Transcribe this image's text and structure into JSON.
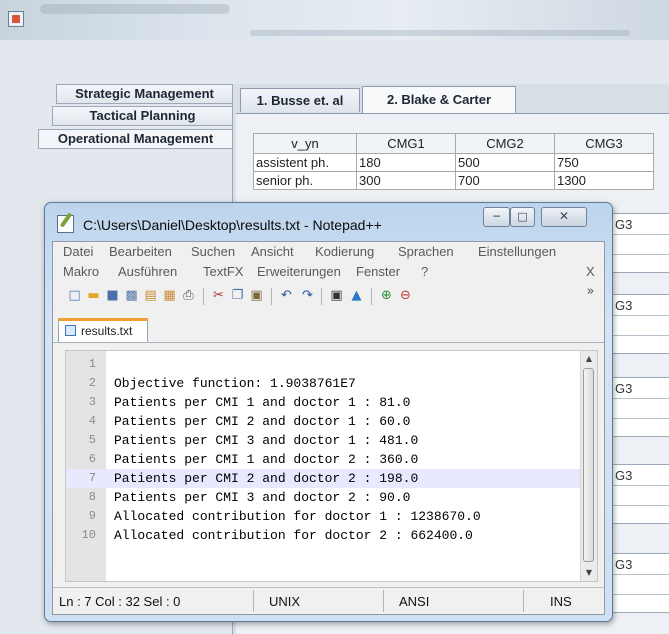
{
  "left_tabs": [
    "Strategic Management",
    "Tactical Planning",
    "Operational Management"
  ],
  "top_tabs": [
    "1. Busse et. al",
    "2. Blake & Carter"
  ],
  "table": {
    "headers": [
      "v_yn",
      "CMG1",
      "CMG2",
      "CMG3"
    ],
    "rows": [
      [
        "assistent ph.",
        "180",
        "500",
        "750"
      ],
      [
        "senior ph.",
        "300",
        "700",
        "1300"
      ]
    ]
  },
  "background_labels": [
    "G3",
    "G3",
    "G3",
    "G3",
    "G3"
  ],
  "notepad": {
    "title": "C:\\Users\\Daniel\\Desktop\\results.txt - Notepad++",
    "menu_row1": [
      "Datei",
      "Bearbeiten",
      "Suchen",
      "Ansicht",
      "Kodierung",
      "Sprachen",
      "Einstellungen"
    ],
    "menu_row2": [
      "Makro",
      "Ausführen",
      "TextFX",
      "Erweiterungen",
      "Fenster",
      "?"
    ],
    "menu_close": "X",
    "toolbar_more": "»",
    "tab_name": "results.txt",
    "lines": [
      {
        "num": "1",
        "text": ""
      },
      {
        "num": "2",
        "text": "Objective function: 1.9038761E7"
      },
      {
        "num": "3",
        "text": "Patients per CMI 1 and doctor 1 : 81.0"
      },
      {
        "num": "4",
        "text": "Patients per CMI 2 and doctor 1 : 60.0"
      },
      {
        "num": "5",
        "text": "Patients per CMI 3 and doctor 1 : 481.0"
      },
      {
        "num": "6",
        "text": "Patients per CMI 1 and doctor 2 : 360.0"
      },
      {
        "num": "7",
        "text": "Patients per CMI 2 and doctor 2 : 198.0"
      },
      {
        "num": "8",
        "text": "Patients per CMI 3 and doctor 2 : 90.0"
      },
      {
        "num": "9",
        "text": "Allocated contribution for doctor 1 : 1238670.0"
      },
      {
        "num": "10",
        "text": "Allocated contribution for doctor 2 : 662400.0"
      }
    ],
    "current_line": 7,
    "status": {
      "position": "Ln : 7    Col : 32    Sel : 0",
      "eol": "UNIX",
      "encoding": "ANSI",
      "mode": "INS"
    }
  }
}
